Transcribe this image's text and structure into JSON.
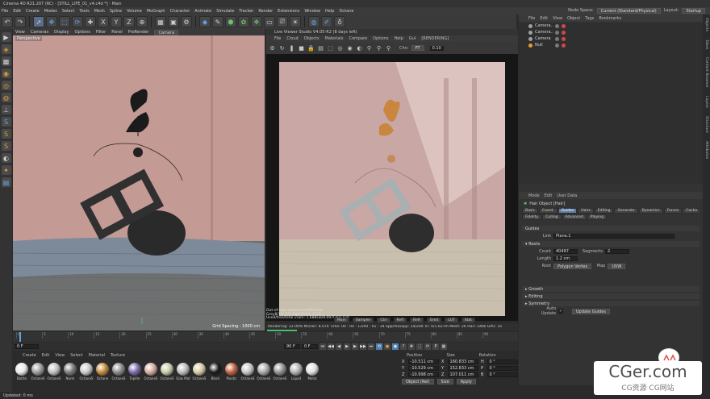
{
  "app": {
    "title": "Cinema 4D R21.207 (RC) - [STILL_LIFE_01_v4.c4d *] - Main",
    "layout_label": "Layout:",
    "layout_value": "Startup",
    "node_space_label": "Node Space:",
    "node_space_value": "Current (Standard/Physical)"
  },
  "menubar": [
    "File",
    "Edit",
    "Create",
    "Modes",
    "Select",
    "Tools",
    "Mesh",
    "Spline",
    "Volume",
    "MoGraph",
    "Character",
    "Animate",
    "Simulate",
    "Tracker",
    "Render",
    "Extensions",
    "Window",
    "Help",
    "Octane"
  ],
  "toolbar": {
    "icons": [
      "undo-icon",
      "redo-icon",
      "live-select-icon",
      "move-icon",
      "scale-icon",
      "rotate-icon",
      "recent-icon",
      "x-axis",
      "y-axis",
      "z-axis",
      "world-icon",
      "render-view-icon",
      "render-picture-icon",
      "render-settings-icon",
      "cube-icon",
      "pen-icon",
      "subdivision-icon",
      "array-icon",
      "deformer-icon",
      "floor-icon",
      "camera-icon",
      "light-icon",
      "octane-icon",
      "tag-icon",
      "bulb-icon"
    ],
    "axis_labels": [
      "X",
      "Y",
      "Z"
    ]
  },
  "viewport": {
    "menu": [
      "View",
      "Cameras",
      "Display",
      "Options",
      "Filter",
      "Panel",
      "ProRender"
    ],
    "camera_dropdown": "Camera",
    "label": "Perspective",
    "grid_spacing": "Grid Spacing : 1000 cm"
  },
  "live_viewer": {
    "title": "Live Viewer Studio V4.05-R2 (8 days left)",
    "menu": [
      "File",
      "Cloud",
      "Objects",
      "Materials",
      "Compare",
      "Options",
      "Help",
      "Gui",
      "[RENDERING]"
    ],
    "channel_label": "Chn:",
    "channel_value": "PT",
    "value_field": "0.10",
    "status_lines": [
      "Out-of-core used/max:0Kb/4Gb",
      "Grey8/16: 1/1      Rgb32/64: 12/3",
      "Used/free/total vram: 1.688Gb/9.097Gb/11Gb"
    ],
    "mini_tabs": [
      "Main",
      "Sampler",
      "Ctrl",
      "Refl",
      "Refr",
      "Emit",
      "LUT",
      "Stat"
    ],
    "render_status": "Rendering: 12.00%   Ms/sec: 8.074   Time: 00 : 00 : 12/00 : 01 : 34   Spp/maxspp: 24/200   Tri: 0/1.627m   Mesh: 26   Hair: 246k   GPU: 35",
    "progress": 0.12
  },
  "object_manager": {
    "menu": [
      "File",
      "Edit",
      "View",
      "Object",
      "Tags",
      "Bookmarks"
    ],
    "rows": [
      {
        "name": "Camera.3",
        "color": "#a0a0a0"
      },
      {
        "name": "Camera.2",
        "color": "#a0a0a0"
      },
      {
        "name": "Camera",
        "color": "#a0a0a0"
      },
      {
        "name": "Null",
        "color": "#e39b3d"
      }
    ]
  },
  "attributes": {
    "menu": [
      "Mode",
      "Edit",
      "User Data"
    ],
    "title": "Hair Object [Hair]",
    "tabs": [
      "Basic",
      "Coord.",
      "Guides",
      "Hairs",
      "Editing",
      "Generate",
      "Dynamics",
      "Forces",
      "Cache",
      "Fidelity",
      "Culling",
      "Advanced",
      "Playing"
    ],
    "active_tab": "Guides",
    "section_title": "Guides",
    "link_label": "Link",
    "link_value": "Plane.1",
    "roots_section": "Roots",
    "count_label": "Count",
    "count_value": "40497",
    "segments_label": "Segments",
    "segments_value": "2",
    "length_label": "Length",
    "length_value": "1.2 cm",
    "root_label": "Root",
    "root_value": "Polygon Vertex",
    "map_label": "Map",
    "map_value": "UVW",
    "collapsed_sections": [
      "Growth",
      "Editing",
      "Symmetry"
    ],
    "auto_update_label": "Auto Update",
    "update_button": "Update Guides"
  },
  "timeline": {
    "ticks": [
      "0",
      "5",
      "10",
      "15",
      "20",
      "25",
      "30",
      "35",
      "40",
      "45",
      "50",
      "55",
      "60",
      "65",
      "70",
      "75",
      "80",
      "85",
      "90"
    ],
    "start_field": "0 F",
    "end_field": "90 F",
    "current_frame": "0 F"
  },
  "materials": {
    "menu": [
      "Create",
      "Edit",
      "View",
      "Select",
      "Material",
      "Texture"
    ],
    "items": [
      {
        "name": "Bottle",
        "color": "#e8e8e8"
      },
      {
        "name": "OctaneS",
        "color": "#9a9a9a"
      },
      {
        "name": "OctaneS",
        "color": "#bfbfbf"
      },
      {
        "name": "Norm",
        "color": "#7a7a7a"
      },
      {
        "name": "OctaneS",
        "color": "#c9c9c9"
      },
      {
        "name": "Octane",
        "color": "#c08a3a"
      },
      {
        "name": "OctaneS",
        "color": "#8a8a8a"
      },
      {
        "name": "Toplite",
        "color": "#7a6aa8"
      },
      {
        "name": "OctaneS",
        "color": "#d6a8a0"
      },
      {
        "name": "OctaneS",
        "color": "#c6c8a8"
      },
      {
        "name": "Glas Mat",
        "color": "#bcbcbc"
      },
      {
        "name": "OctaneS",
        "color": "#d6c8a0"
      },
      {
        "name": "Black",
        "color": "#1a1a1a"
      },
      {
        "name": "Plastic",
        "color": "#c06040"
      },
      {
        "name": "OctaneS",
        "color": "#c5c5c5"
      },
      {
        "name": "OctaneS",
        "color": "#a8a8a8"
      },
      {
        "name": "OctaneS",
        "color": "#909090"
      },
      {
        "name": "Liquid",
        "color": "#b0b0b0"
      },
      {
        "name": "Metal",
        "color": "#e0e0e0"
      }
    ]
  },
  "coordinates": {
    "headers": [
      "Position",
      "Size",
      "Rotation"
    ],
    "rows": [
      {
        "axis": "X",
        "pos": "-10.511 cm",
        "size": "160.833 cm",
        "rot_axis": "H",
        "rot": "0 °"
      },
      {
        "axis": "Y",
        "pos": "-10.529 cm",
        "size": "152.833 cm",
        "rot_axis": "P",
        "rot": "0 °"
      },
      {
        "axis": "Z",
        "pos": "-10.998 cm",
        "size": "107.011 cm",
        "rot_axis": "B",
        "rot": "0 °"
      }
    ],
    "mode_dropdown": "Object (Rel)",
    "size_dropdown": "Size",
    "apply_button": "Apply"
  },
  "statusbar": "Updated: 0 ms",
  "right_side_tabs": [
    "Objects",
    "Takes",
    "Content Browser",
    "Layers",
    "Structure",
    "Attributes"
  ],
  "watermark": {
    "big": "CGer.com",
    "small": "CG资源  CG网站"
  }
}
